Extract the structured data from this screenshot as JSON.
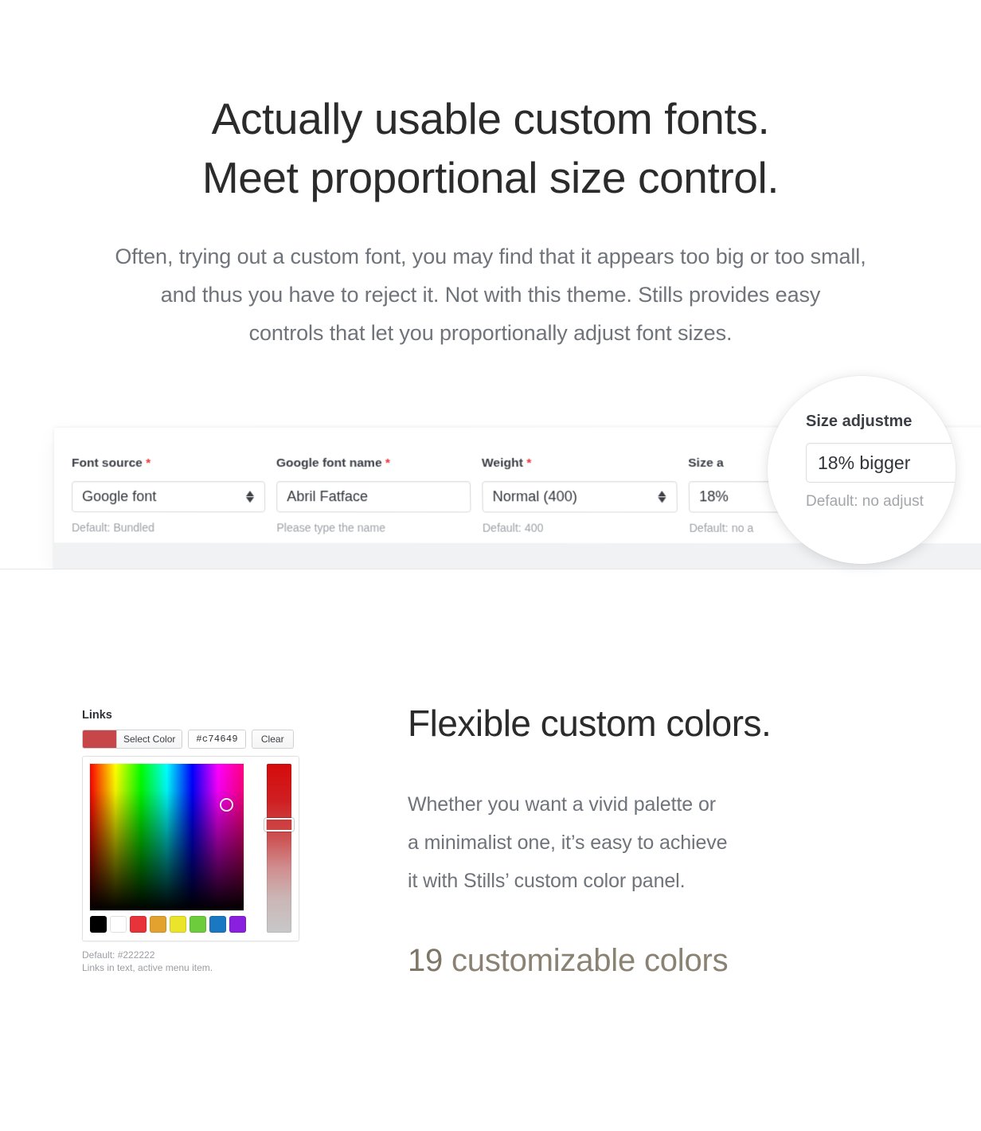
{
  "hero": {
    "heading_line1": "Actually usable custom fonts.",
    "heading_line2": "Meet proportional size control.",
    "sub_line1": "Often, trying out a custom font, you may find that it appears too big or too small,",
    "sub_line2": "and thus you have to reject it. Not with this theme. Stills provides easy",
    "sub_line3": "controls that let you proportionally adjust font sizes."
  },
  "font_panel": {
    "fields": [
      {
        "label": "Font source",
        "required": "*",
        "value": "Google font",
        "help": "Default: Bundled",
        "type": "select"
      },
      {
        "label": "Google font name",
        "required": "*",
        "value": "Abril Fatface",
        "help": "Please type the name",
        "type": "text"
      },
      {
        "label": "Weight",
        "required": "*",
        "value": "Normal (400)",
        "help": "Default: 400",
        "type": "select"
      },
      {
        "label": "Size a",
        "required": "",
        "value": "18% ",
        "help": "Default: no a",
        "type": "select"
      }
    ]
  },
  "magnifier": {
    "label": "Size adjustme",
    "value": "18% bigger",
    "help": "Default: no adjust"
  },
  "color_panel": {
    "title": "Links",
    "select_color_label": "Select Color",
    "hex_value": "#c74649",
    "clear_label": "Clear",
    "current_color": "#c74649",
    "default_help_line1": "Default: #222222",
    "default_help_line2": "Links in text, active menu item.",
    "preset_swatches": [
      "#000000",
      "#ffffff",
      "#e8333a",
      "#e3a12e",
      "#ece42a",
      "#6dcc3c",
      "#1a78c2",
      "#8a1fe0"
    ]
  },
  "colors_text": {
    "heading": "Flexible custom colors.",
    "body_line1": "Whether you want a vivid palette or",
    "body_line2": "a minimalist one, it’s easy to achieve",
    "body_line3": "it with Stills’ custom color panel.",
    "stat_number": "19",
    "stat_label": " customizable colors"
  }
}
